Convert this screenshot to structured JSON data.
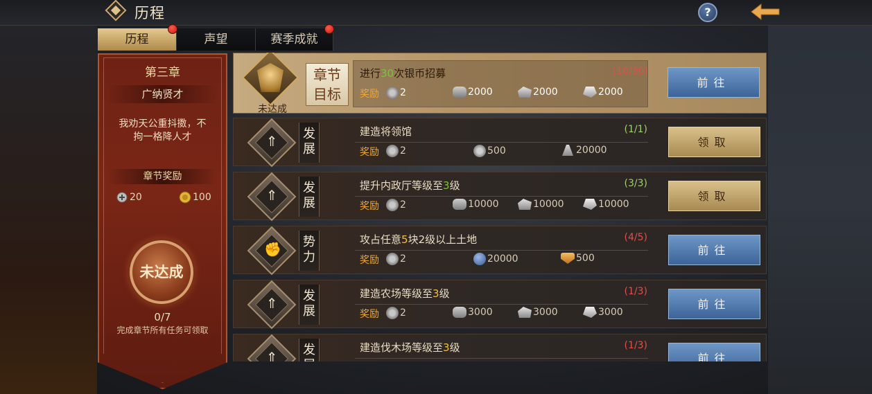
{
  "header": {
    "title": "历程",
    "help": "?"
  },
  "tabs": [
    {
      "label": "历程",
      "badge": true
    },
    {
      "label": "声望",
      "badge": false
    },
    {
      "label": "赛季成就",
      "badge": true
    }
  ],
  "chapter": {
    "name": "第三章",
    "subtitle": "广纳贤才",
    "description_line1": "我劝天公重抖擞，不",
    "description_line2": "拘一格降人才",
    "reward_title": "章节奖励",
    "rewards": [
      {
        "icon": "horn-icon",
        "amount": "20"
      },
      {
        "icon": "gold-coin-icon",
        "amount": "100"
      }
    ],
    "status": "未达成",
    "progress": "0/7",
    "hint": "完成章节所有任务可领取"
  },
  "goal": {
    "status": "未达成",
    "label_line1": "章节",
    "label_line2": "目标",
    "title_pre": "进行",
    "title_num": "30",
    "title_post": "次银币招募",
    "progress": "(10/30)",
    "reward_label": "奖励",
    "rewards": [
      "2",
      "2000",
      "2000",
      "2000"
    ],
    "button": "前往"
  },
  "tasks": [
    {
      "category_line1": "发",
      "category_line2": "展",
      "title_pre": "建造将领馆",
      "title_num": "",
      "title_post": "",
      "progress": "(1/1)",
      "done": true,
      "reward_label": "奖励",
      "rewards": [
        {
          "icon": "horn-icon",
          "amount": "2"
        },
        {
          "icon": "fame-icon",
          "amount": "500"
        },
        {
          "icon": "food-icon",
          "amount": "20000"
        }
      ],
      "button": "领取",
      "button_type": "claim"
    },
    {
      "category_line1": "发",
      "category_line2": "展",
      "title_pre": "提升内政厅等级至",
      "title_num": "3",
      "title_post": "级",
      "progress": "(3/3)",
      "done": true,
      "reward_label": "奖励",
      "rewards": [
        {
          "icon": "horn-icon",
          "amount": "2"
        },
        {
          "icon": "wood-icon",
          "amount": "10000"
        },
        {
          "icon": "stone-icon",
          "amount": "10000"
        },
        {
          "icon": "iron-icon",
          "amount": "10000"
        }
      ],
      "button": "领取",
      "button_type": "claim"
    },
    {
      "category_line1": "势",
      "category_line2": "力",
      "title_pre": "攻占任意",
      "title_num": "5",
      "title_post": "块2级以上土地",
      "progress": "(4/5)",
      "done": false,
      "reward_label": "奖励",
      "rewards": [
        {
          "icon": "horn-icon",
          "amount": "2"
        },
        {
          "icon": "jade-icon",
          "amount": "20000"
        },
        {
          "icon": "shield-icon",
          "amount": "500"
        }
      ],
      "button": "前往",
      "button_type": "go"
    },
    {
      "category_line1": "发",
      "category_line2": "展",
      "title_pre": "建造农场等级至",
      "title_num": "3",
      "title_post": "级",
      "progress": "(1/3)",
      "done": false,
      "reward_label": "奖励",
      "rewards": [
        {
          "icon": "horn-icon",
          "amount": "2"
        },
        {
          "icon": "wood-icon",
          "amount": "3000"
        },
        {
          "icon": "stone-icon",
          "amount": "3000"
        },
        {
          "icon": "iron-icon",
          "amount": "3000"
        }
      ],
      "button": "前往",
      "button_type": "go"
    },
    {
      "category_line1": "发",
      "category_line2": "展",
      "title_pre": "建造伐木场等级至",
      "title_num": "3",
      "title_post": "级",
      "progress": "(1/3)",
      "done": false,
      "reward_label": "",
      "rewards": [],
      "button": "前往",
      "button_type": "go"
    }
  ]
}
